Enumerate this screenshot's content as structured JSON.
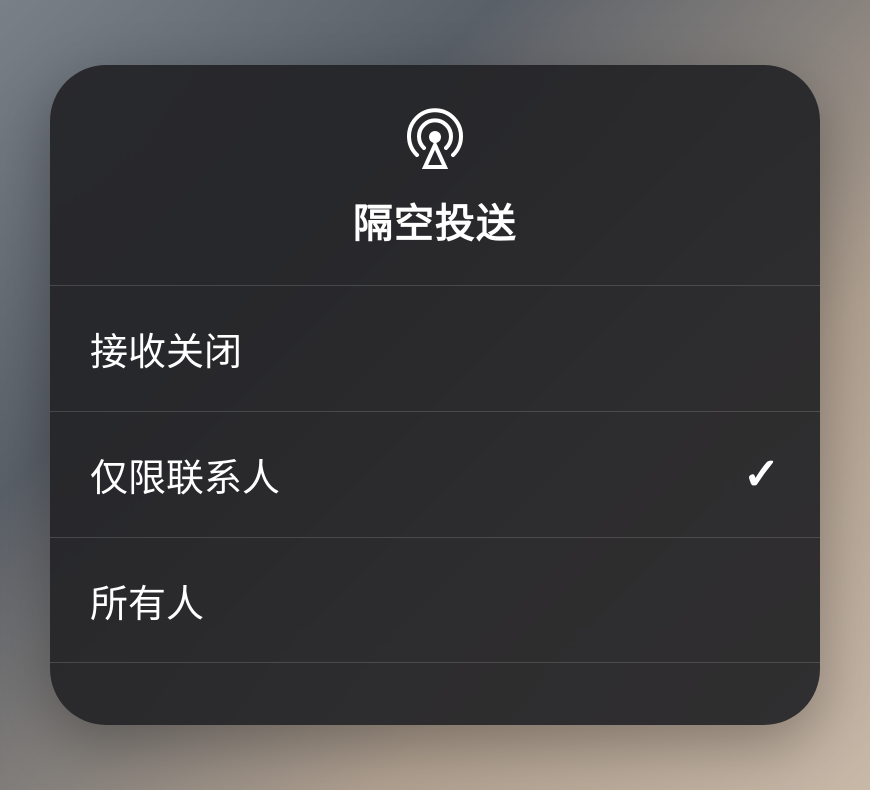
{
  "title": "隔空投送",
  "icon_name": "airdrop-icon",
  "options": [
    {
      "label": "接收关闭",
      "selected": false
    },
    {
      "label": "仅限联系人",
      "selected": true
    },
    {
      "label": "所有人",
      "selected": false
    }
  ]
}
